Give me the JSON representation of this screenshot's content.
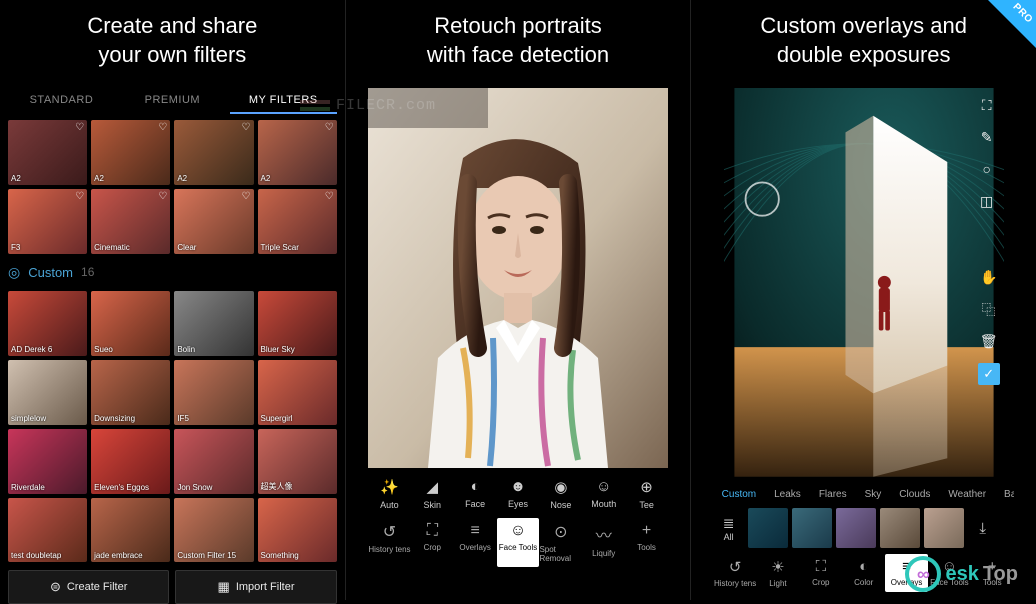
{
  "panel1": {
    "title": "Create and share\nyour own filters",
    "tabs": [
      {
        "label": "STANDARD",
        "active": false
      },
      {
        "label": "PREMIUM",
        "active": false
      },
      {
        "label": "MY FILTERS",
        "active": true
      }
    ],
    "fav_section": [
      {
        "label": "A2",
        "heart": true,
        "bg": "linear-gradient(135deg,#7a3a3a,#3a1a1a)"
      },
      {
        "label": "A2",
        "heart": true,
        "bg": "linear-gradient(135deg,#b85a3a,#4a2a1a)"
      },
      {
        "label": "A2",
        "heart": true,
        "bg": "linear-gradient(135deg,#9a5a3a,#3a2a1a)"
      },
      {
        "label": "A2",
        "heart": true,
        "bg": "linear-gradient(135deg,#b8654a,#4a2a2a)"
      },
      {
        "label": "F3",
        "heart": true,
        "bg": "linear-gradient(135deg,#d8654a,#6a2a2a)"
      },
      {
        "label": "Cinematic",
        "heart": true,
        "bg": "linear-gradient(135deg,#c8554a,#5a2a2a)"
      },
      {
        "label": "Clear",
        "heart": true,
        "bg": "linear-gradient(135deg,#d8755a,#6a3a2a)"
      },
      {
        "label": "Triple Scar",
        "heart": true,
        "bg": "linear-gradient(135deg,#c8654a,#5a2a2a)"
      }
    ],
    "custom_header": {
      "name": "Custom",
      "count": "16"
    },
    "custom_section": [
      {
        "label": "AD Derek 6",
        "bg": "linear-gradient(135deg,#c84a3a,#4a1a1a)"
      },
      {
        "label": "Sueo",
        "bg": "linear-gradient(135deg,#d8654a,#5a2a1a)"
      },
      {
        "label": "Bolin",
        "bg": "linear-gradient(135deg,#888,#333)"
      },
      {
        "label": "Bluer Sky",
        "bg": "linear-gradient(135deg,#c84a3a,#4a1a1a)"
      },
      {
        "label": "simplelow",
        "bg": "linear-gradient(135deg,#d0c0b0,#6a5a4a)"
      },
      {
        "label": "Downsizing",
        "bg": "linear-gradient(135deg,#b8654a,#4a2a1a)"
      },
      {
        "label": "IF5",
        "bg": "linear-gradient(135deg,#c8755a,#5a3a2a)"
      },
      {
        "label": "Supergirl",
        "bg": "linear-gradient(135deg,#d8654a,#6a2a2a)"
      },
      {
        "label": "Riverdale",
        "bg": "linear-gradient(135deg,#c8355a,#4a1a2a)"
      },
      {
        "label": "Eleven's Eggos",
        "bg": "linear-gradient(135deg,#d8453a,#6a1a1a)"
      },
      {
        "label": "Jon Snow",
        "bg": "linear-gradient(135deg,#c8555a,#5a2a2a)"
      },
      {
        "label": "超美人像",
        "bg": "linear-gradient(135deg,#c8655a,#5a2a2a)"
      },
      {
        "label": "test doubletap",
        "bg": "linear-gradient(135deg,#c8554a,#5a2a1a)"
      },
      {
        "label": "jade embrace",
        "bg": "linear-gradient(135deg,#b8654a,#4a2a1a)"
      },
      {
        "label": "Custom Filter 15",
        "bg": "linear-gradient(135deg,#c8755a,#5a3a2a)"
      },
      {
        "label": "Something",
        "bg": "linear-gradient(135deg,#d8654a,#6a2a2a)"
      }
    ],
    "actions": {
      "create": "Create Filter",
      "import": "Import Filter"
    }
  },
  "panel2": {
    "title": "Retouch portraits\nwith face detection",
    "retouch": [
      {
        "label": "Auto",
        "icon": "✨"
      },
      {
        "label": "Skin",
        "icon": "◢"
      },
      {
        "label": "Face",
        "icon": "◐"
      },
      {
        "label": "Eyes",
        "icon": "☻"
      },
      {
        "label": "Nose",
        "icon": "◉"
      },
      {
        "label": "Mouth",
        "icon": "☺"
      },
      {
        "label": "Tee",
        "icon": "⊕"
      }
    ],
    "tools": [
      {
        "label": "History tens",
        "icon": "↺"
      },
      {
        "label": "Crop",
        "icon": "⛶"
      },
      {
        "label": "Overlays",
        "icon": "≡"
      },
      {
        "label": "Face Tools",
        "icon": "☺",
        "active": true
      },
      {
        "label": "Spot Removal",
        "icon": "⊙"
      },
      {
        "label": "Liquify",
        "icon": "〰"
      },
      {
        "label": "Tools",
        "icon": "+"
      }
    ]
  },
  "panel3": {
    "title": "Custom overlays and\ndouble exposures",
    "pro_badge": "PRO",
    "right_icons": [
      "⛶",
      "✎",
      "○",
      "◫"
    ],
    "mid_icons": [
      "✋",
      "⿻",
      "🗑"
    ],
    "confirm": "✓",
    "overlay_tabs": [
      {
        "label": "Custom",
        "active": true
      },
      {
        "label": "Leaks",
        "active": false
      },
      {
        "label": "Flares",
        "active": false
      },
      {
        "label": "Sky",
        "active": false
      },
      {
        "label": "Clouds",
        "active": false
      },
      {
        "label": "Weather",
        "active": false
      },
      {
        "label": "Backdr",
        "active": false
      }
    ],
    "overlay_thumbs": [
      {
        "bg": "linear-gradient(135deg,#1a4a5a,#0a2a3a)"
      },
      {
        "bg": "linear-gradient(135deg,#3a6a7a,#1a3a4a)"
      },
      {
        "bg": "linear-gradient(135deg,#7a6a9a,#4a3a5a)"
      },
      {
        "bg": "linear-gradient(135deg,#9a8a7a,#5a4a3a)"
      },
      {
        "bg": "linear-gradient(135deg,#baa090,#7a6a5a)"
      }
    ],
    "all_label": "All",
    "download": "⤓",
    "tools": [
      {
        "label": "History tens",
        "icon": "↺"
      },
      {
        "label": "Light",
        "icon": "☀"
      },
      {
        "label": "Crop",
        "icon": "⛶"
      },
      {
        "label": "Color",
        "icon": "◐"
      },
      {
        "label": "Overlays",
        "icon": "≡",
        "active": true
      },
      {
        "label": "Face Tools",
        "icon": "☺"
      },
      {
        "label": "Tools",
        "icon": "+"
      }
    ]
  },
  "watermarks": {
    "filecr": "FILECR.com",
    "desktop": {
      "brand1": "esk",
      "brand2": "Top"
    }
  }
}
